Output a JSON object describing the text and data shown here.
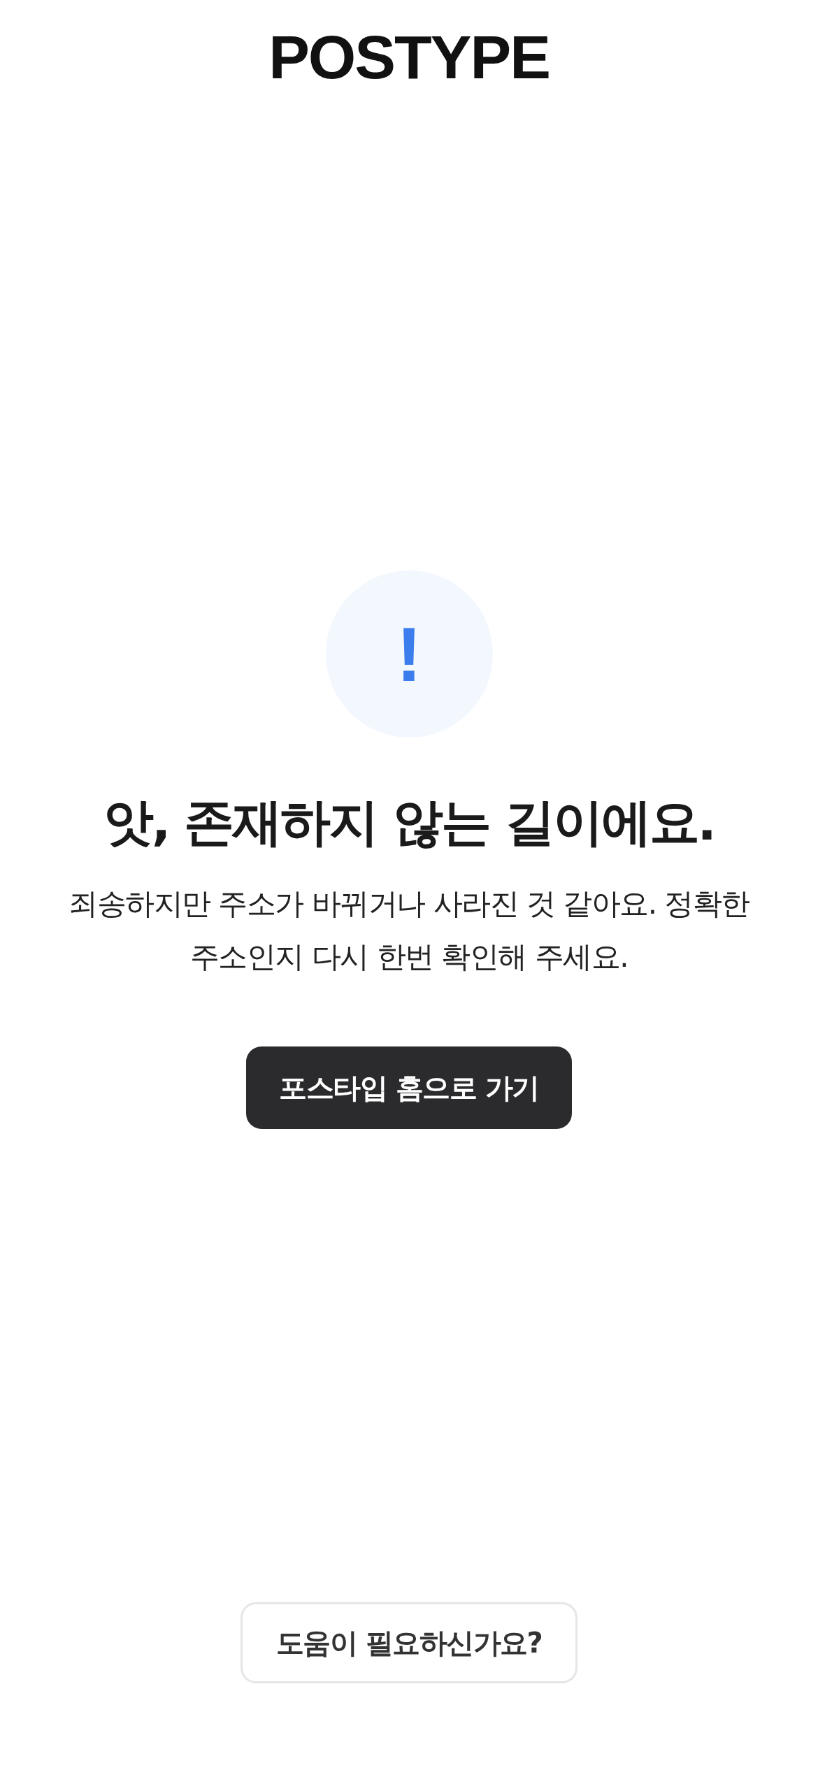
{
  "header": {
    "logo": "POSTYPE"
  },
  "error": {
    "icon": "!",
    "title": "앗, 존재하지 않는 길이에요.",
    "message": "죄송하지만 주소가 바뀌거나 사라진 것 같아요. 정확한 주소인지 다시 한번 확인해 주세요.",
    "button": "포스타입 홈으로 가기"
  },
  "help_button": "도움이 필요하신가요?"
}
